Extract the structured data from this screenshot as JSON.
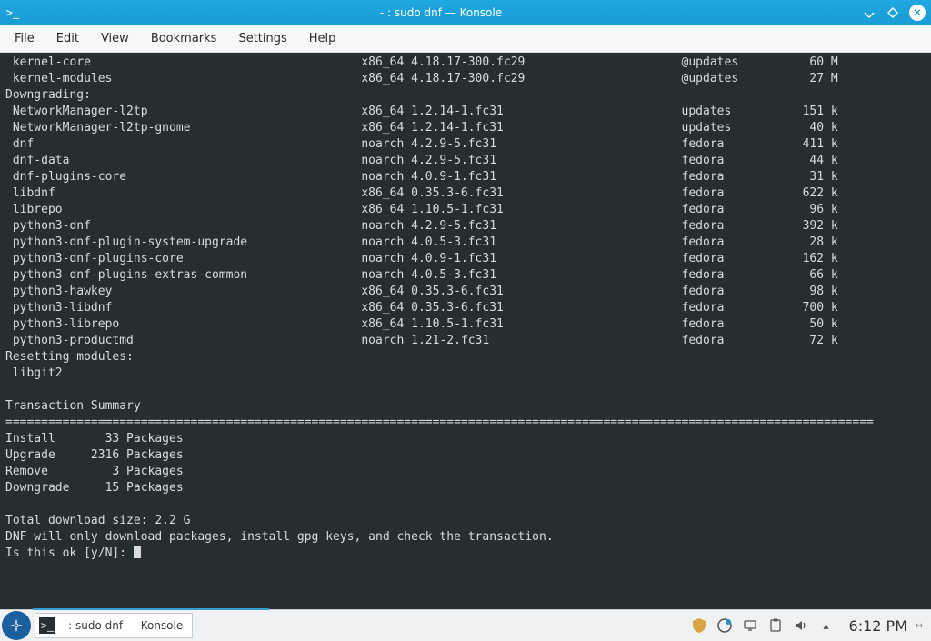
{
  "window": {
    "title": "- : sudo dnf — Konsole"
  },
  "menubar": {
    "items": [
      "File",
      "Edit",
      "View",
      "Bookmarks",
      "Settings",
      "Help"
    ]
  },
  "terminal": {
    "kernel_rows": [
      {
        "name": " kernel-core",
        "arch": "x86_64",
        "ver": "4.18.17-300.fc29",
        "repo": "@updates",
        "size": "60 M"
      },
      {
        "name": " kernel-modules",
        "arch": "x86_64",
        "ver": "4.18.17-300.fc29",
        "repo": "@updates",
        "size": "27 M"
      }
    ],
    "downgrading_header": "Downgrading:",
    "downgrade_rows": [
      {
        "name": " NetworkManager-l2tp",
        "arch": "x86_64",
        "ver": "1.2.14-1.fc31",
        "repo": "updates",
        "size": "151 k"
      },
      {
        "name": " NetworkManager-l2tp-gnome",
        "arch": "x86_64",
        "ver": "1.2.14-1.fc31",
        "repo": "updates",
        "size": "40 k"
      },
      {
        "name": " dnf",
        "arch": "noarch",
        "ver": "4.2.9-5.fc31",
        "repo": "fedora",
        "size": "411 k"
      },
      {
        "name": " dnf-data",
        "arch": "noarch",
        "ver": "4.2.9-5.fc31",
        "repo": "fedora",
        "size": "44 k"
      },
      {
        "name": " dnf-plugins-core",
        "arch": "noarch",
        "ver": "4.0.9-1.fc31",
        "repo": "fedora",
        "size": "31 k"
      },
      {
        "name": " libdnf",
        "arch": "x86_64",
        "ver": "0.35.3-6.fc31",
        "repo": "fedora",
        "size": "622 k"
      },
      {
        "name": " librepo",
        "arch": "x86_64",
        "ver": "1.10.5-1.fc31",
        "repo": "fedora",
        "size": "96 k"
      },
      {
        "name": " python3-dnf",
        "arch": "noarch",
        "ver": "4.2.9-5.fc31",
        "repo": "fedora",
        "size": "392 k"
      },
      {
        "name": " python3-dnf-plugin-system-upgrade",
        "arch": "noarch",
        "ver": "4.0.5-3.fc31",
        "repo": "fedora",
        "size": "28 k"
      },
      {
        "name": " python3-dnf-plugins-core",
        "arch": "noarch",
        "ver": "4.0.9-1.fc31",
        "repo": "fedora",
        "size": "162 k"
      },
      {
        "name": " python3-dnf-plugins-extras-common",
        "arch": "noarch",
        "ver": "4.0.5-3.fc31",
        "repo": "fedora",
        "size": "66 k"
      },
      {
        "name": " python3-hawkey",
        "arch": "x86_64",
        "ver": "0.35.3-6.fc31",
        "repo": "fedora",
        "size": "98 k"
      },
      {
        "name": " python3-libdnf",
        "arch": "x86_64",
        "ver": "0.35.3-6.fc31",
        "repo": "fedora",
        "size": "700 k"
      },
      {
        "name": " python3-librepo",
        "arch": "x86_64",
        "ver": "1.10.5-1.fc31",
        "repo": "fedora",
        "size": "50 k"
      },
      {
        "name": " python3-productmd",
        "arch": "noarch",
        "ver": "1.21-2.fc31",
        "repo": "fedora",
        "size": "72 k"
      }
    ],
    "reset_header": "Resetting modules:",
    "reset_module": " libgit2",
    "summary_header": "Transaction Summary",
    "summary_rows": [
      {
        "label": "Install",
        "count": "33",
        "unit": "Packages"
      },
      {
        "label": "Upgrade",
        "count": "2316",
        "unit": "Packages"
      },
      {
        "label": "Remove",
        "count": "3",
        "unit": "Packages"
      },
      {
        "label": "Downgrade",
        "count": "15",
        "unit": "Packages"
      }
    ],
    "total_line": "Total download size: 2.2 G",
    "note_line": "DNF will only download packages, install gpg keys, and check the transaction.",
    "prompt": "Is this ok [y/N]: "
  },
  "taskbar": {
    "task_label": "- : sudo dnf — Konsole",
    "clock": "6:12 PM"
  }
}
